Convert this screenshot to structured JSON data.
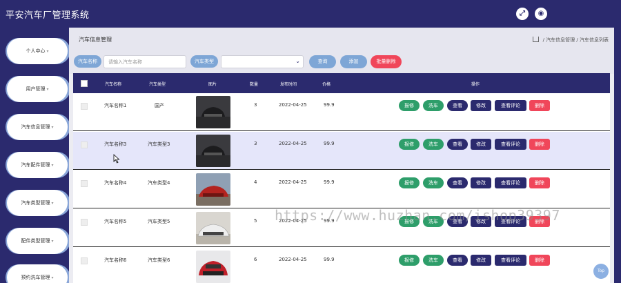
{
  "app": {
    "title": "平安汽车厂管理系统"
  },
  "header": {
    "icon_fullscreen": "expand-icon",
    "icon_user": "user-icon"
  },
  "sidebar": {
    "items": [
      {
        "label": "个人中心"
      },
      {
        "label": "用户管理"
      },
      {
        "label": "汽车信息管理"
      },
      {
        "label": "汽车配件管理"
      },
      {
        "label": "汽车类型管理"
      },
      {
        "label": "配件类型管理"
      },
      {
        "label": "预约洗车管理"
      }
    ]
  },
  "page": {
    "heading": "汽车信息管理",
    "breadcrumb": [
      "汽车信息管理",
      "汽车信息列表"
    ]
  },
  "search": {
    "name_label": "汽车名称",
    "name_placeholder": "请输入汽车名称",
    "type_label": "汽车类型",
    "query_btn": "查询",
    "add_btn": "添加",
    "batch_delete_btn": "批量删除"
  },
  "table": {
    "headers": [
      "汽车名称",
      "汽车类型",
      "图片",
      "数量",
      "发布时间",
      "价格",
      "操作"
    ],
    "rows": [
      {
        "name": "汽车名称1",
        "type": "国产",
        "qty": "3",
        "date": "2022-04-25",
        "price": "99.9"
      },
      {
        "name": "汽车名称3",
        "type": "汽车类型3",
        "qty": "3",
        "date": "2022-04-25",
        "price": "99.9"
      },
      {
        "name": "汽车名称4",
        "type": "汽车类型4",
        "qty": "4",
        "date": "2022-04-25",
        "price": "99.9"
      },
      {
        "name": "汽车名称5",
        "type": "汽车类型5",
        "qty": "5",
        "date": "2022-04-25",
        "price": "99.9"
      },
      {
        "name": "汽车名称6",
        "type": "汽车类型6",
        "qty": "6",
        "date": "2022-04-25",
        "price": "99.9"
      }
    ],
    "actions": [
      "报修",
      "洗车",
      "查看",
      "修改",
      "查看评论",
      "删除"
    ]
  },
  "watermark": "https://www.huzhan.com/ishop39397",
  "top_btn": "Top",
  "colors": {
    "navy": "#2b2a6e",
    "green": "#2e9e6a",
    "red": "#f0465a",
    "light_blue": "#7ea6d6"
  }
}
